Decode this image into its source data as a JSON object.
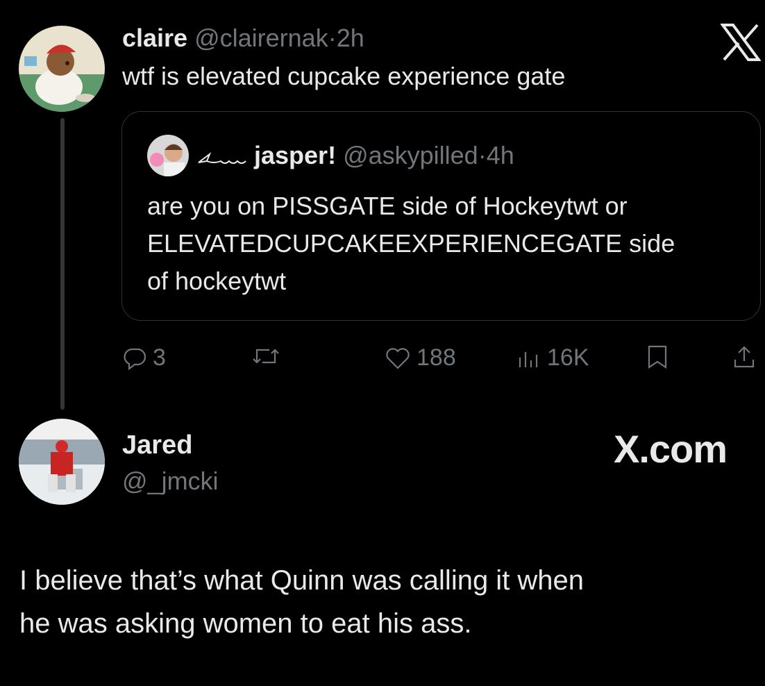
{
  "tweet": {
    "author_name": "claire",
    "author_handle": "@clairernak",
    "time": "2h",
    "text": "wtf is elevated cupcake experience gate"
  },
  "quote": {
    "author_name": "jasper!",
    "author_handle": "@askypilled",
    "time": "4h",
    "text_lines": [
      "are you on PISSGATE side of Hockeytwt or",
      "ELEVATEDCUPCAKEEXPERIENCEGATE side",
      "of hockeytwt"
    ]
  },
  "actions": {
    "replies": "3",
    "likes": "188",
    "views": "16K"
  },
  "reply": {
    "author_name": "Jared",
    "author_handle": "@_jmcki",
    "brand": "X.com",
    "text_lines": [
      "I believe that’s what Quinn was calling it when",
      "he was asking women to eat his ass."
    ]
  },
  "icons": [
    "x-logo-icon",
    "reply-icon",
    "retweet-icon",
    "like-icon",
    "views-icon",
    "bookmark-icon",
    "share-icon"
  ],
  "colors": {
    "background": "#000000",
    "text": "#e7e9ea",
    "muted": "#71767b",
    "border": "#2f3336"
  }
}
